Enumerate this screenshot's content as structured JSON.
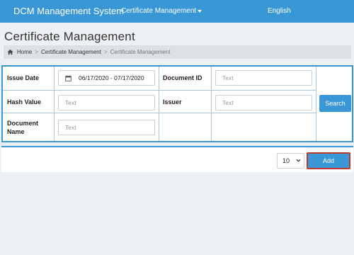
{
  "navbar": {
    "brand": "DCM Management System",
    "menu_label": "Certificate Management",
    "language": "English"
  },
  "page": {
    "title": "Certificate Management"
  },
  "breadcrumb": {
    "home": "Home",
    "section": "Certificate Management",
    "current": "Certificate Management",
    "separator": ">"
  },
  "form": {
    "issue_date": {
      "label": "Issue Date",
      "value": "06/17/2020 - 07/17/2020",
      "icon": "calendar-icon"
    },
    "document_id": {
      "label": "Document ID",
      "placeholder": "Text"
    },
    "hash_value": {
      "label": "Hash Value",
      "placeholder": "Text"
    },
    "issuer": {
      "label": "Issuer",
      "placeholder": "Text"
    },
    "document_name": {
      "label_line1": "Document",
      "label_line2": "Name",
      "placeholder": "Text"
    },
    "search_label": "Search"
  },
  "footer": {
    "page_size": "10",
    "add_label": "Add"
  },
  "colors": {
    "primary": "#3a97d6",
    "highlight_border": "#c0392b",
    "background": "#eef1f4"
  }
}
